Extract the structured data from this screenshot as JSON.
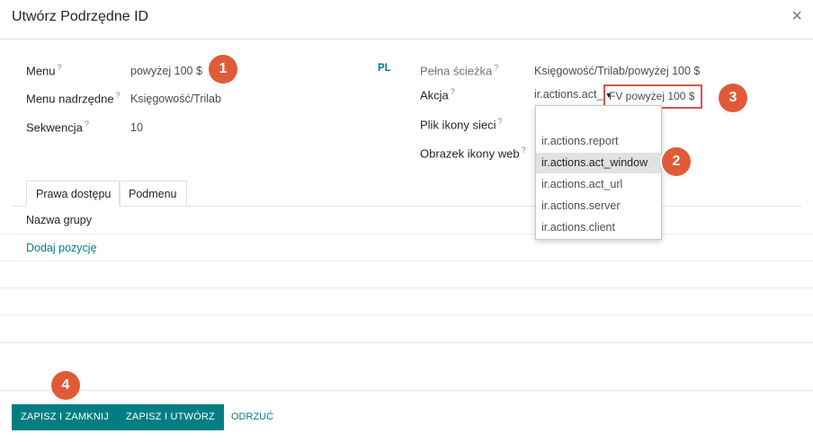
{
  "dialog": {
    "title": "Utwórz Podrzędne ID",
    "close_icon": "×"
  },
  "form": {
    "menu_label": "Menu",
    "menu_value": "powyżej 100 $",
    "parent_label": "Menu nadrzędne",
    "parent_value": "Księgowość/Trilab",
    "sequence_label": "Sekwencja",
    "sequence_value": "10",
    "lang": "PL",
    "fullpath_label": "Pełna ścieżka",
    "fullpath_value": "Księgowość/Trilab/powyżej 100 $",
    "action_label": "Akcja",
    "action_type": "ir.actions.act_",
    "action_caret": "▼",
    "action_value": "FV powyżej 100 $",
    "icon_label": "Plik ikony sieci",
    "image_label": "Obrazek ikony web",
    "help_mark": "?"
  },
  "dropdown": {
    "items": [
      "ir.actions.report",
      "ir.actions.act_window",
      "ir.actions.act_url",
      "ir.actions.server",
      "ir.actions.client"
    ]
  },
  "tabs": [
    {
      "label": "Prawa dostępu"
    },
    {
      "label": "Podmenu"
    }
  ],
  "grid": {
    "column": "Nazwa grupy",
    "add_line": "Dodaj pozycję"
  },
  "footer": {
    "save_close": "ZAPISZ I ZAMKNIJ",
    "save_new": "ZAPISZ I UTWÓRZ",
    "discard": "ODRZUĆ"
  },
  "badges": [
    "1",
    "2",
    "3",
    "4"
  ],
  "colors": {
    "primary": "#017e84",
    "badge": "#e05a38",
    "highlight_border": "#d9534f"
  }
}
